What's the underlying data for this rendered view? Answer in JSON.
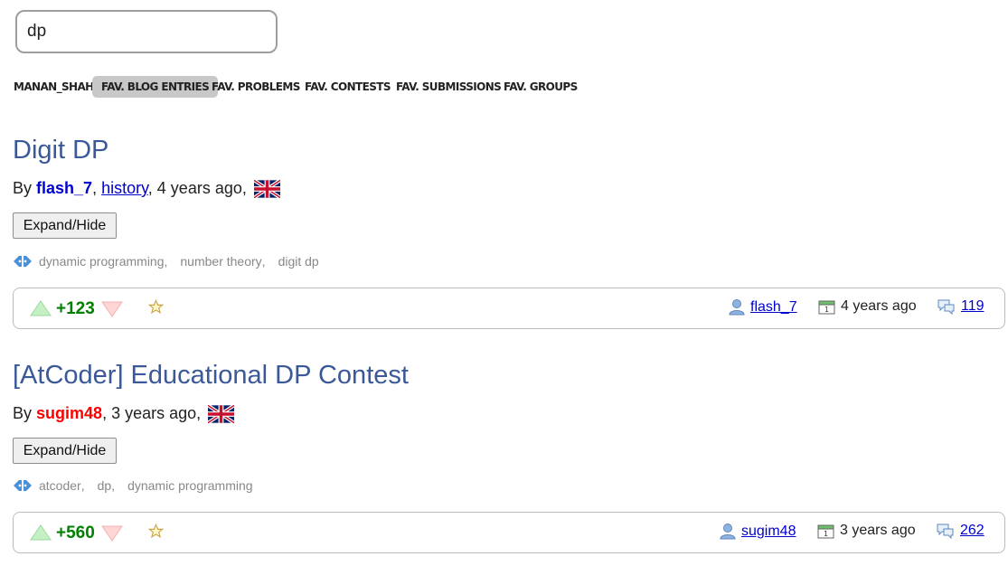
{
  "search": {
    "value": "dp"
  },
  "tabs": [
    {
      "label": "MANAN_SHAH",
      "active": false
    },
    {
      "label": "FAV. BLOG ENTRIES",
      "active": true
    },
    {
      "label": "FAV. PROBLEMS",
      "active": false
    },
    {
      "label": "FAV. CONTESTS",
      "active": false
    },
    {
      "label": "FAV. SUBMISSIONS",
      "active": false
    },
    {
      "label": "FAV. GROUPS",
      "active": false
    }
  ],
  "entries": [
    {
      "title": "Digit DP",
      "by": "By",
      "author": "flash_7",
      "author_color": "#0000cc",
      "history": "history",
      "time": "4 years ago",
      "expand_label": "Expand/Hide",
      "tags": [
        "dynamic programming",
        "number theory",
        "digit dp"
      ],
      "rating": "+123",
      "user": "flash_7",
      "date": "4 years ago",
      "comments": "119",
      "language_flag": "uk-flag-icon"
    },
    {
      "title": "[AtCoder] Educational DP Contest",
      "by": "By",
      "author": "sugim48",
      "author_color": "#ff0000",
      "time": "3 years ago",
      "expand_label": "Expand/Hide",
      "tags": [
        "atcoder",
        "dp",
        "dynamic programming"
      ],
      "rating": "+560",
      "user": "sugim48",
      "date": "3 years ago",
      "comments": "262",
      "language_flag": "uk-flag-icon"
    }
  ],
  "icons": {
    "tags": "tags-icon",
    "vote_up": "vote-up-icon",
    "vote_down": "vote-down-icon",
    "favourite": "star-icon",
    "user": "user-icon",
    "date": "calendar-icon",
    "comments": "comments-icon"
  },
  "colors": {
    "title": "#3b5998",
    "link": "#0000cc",
    "rating": "#008000",
    "tag": "#888888",
    "active_tab_bg": "#c8c8c8"
  }
}
